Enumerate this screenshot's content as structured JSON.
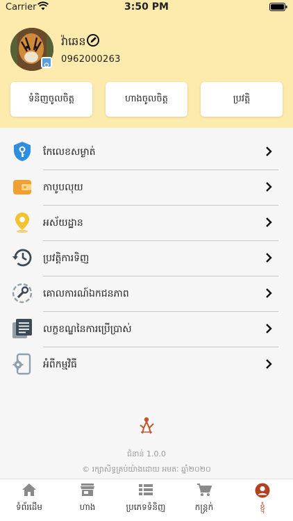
{
  "status": {
    "carrier": "Carrier",
    "time": "3:50 PM"
  },
  "profile": {
    "name": "វ៉ាឆេន",
    "phone": "0962000263"
  },
  "quick_actions": [
    {
      "label": "ទំនិញចូលចិត្ត"
    },
    {
      "label": "ហាងចូលចិត្ត"
    },
    {
      "label": "ប្រវត្តិ"
    }
  ],
  "menu": [
    {
      "label": "កែលេខសម្ងាត់",
      "icon": "shield-key-icon"
    },
    {
      "label": "កាបូបលុយ",
      "icon": "wallet-icon"
    },
    {
      "label": "អស័យដ្ឋាន",
      "icon": "location-pin-icon"
    },
    {
      "label": "ប្រវត្តិការទិញ",
      "icon": "history-icon"
    },
    {
      "label": "គោលការណ៍ឯកជនភាព",
      "icon": "tools-icon"
    },
    {
      "label": "លក្ខខណ្ឌនៃការប្រើប្រាស់",
      "icon": "document-list-icon"
    },
    {
      "label": "អំពីកម្មវិធី",
      "icon": "app-settings-icon"
    }
  ],
  "footer": {
    "logo_text": "អមតៈ",
    "version": "ជំនាន់ 1.0.0",
    "copyright": "© រក្សាសិទ្ធគ្រប់យ៉ាងដោយ អមតៈ ឆ្នាំ២០២០"
  },
  "tabs": [
    {
      "label": "ទំព័រដើម",
      "icon": "home-icon"
    },
    {
      "label": "ហាង",
      "icon": "store-icon"
    },
    {
      "label": "ប្រភេទទំនិញ",
      "icon": "category-list-icon"
    },
    {
      "label": "កន្ត្រក់",
      "icon": "cart-icon"
    },
    {
      "label": "ខ្ញុំ",
      "icon": "account-icon",
      "active": true
    }
  ],
  "colors": {
    "header_bg": "#fdeaad",
    "accent": "#b3411d",
    "icon_blue": "#2f8ee0",
    "icon_yellow": "#f2c230",
    "icon_orange": "#f0a030",
    "icon_slate": "#3b4a56"
  }
}
